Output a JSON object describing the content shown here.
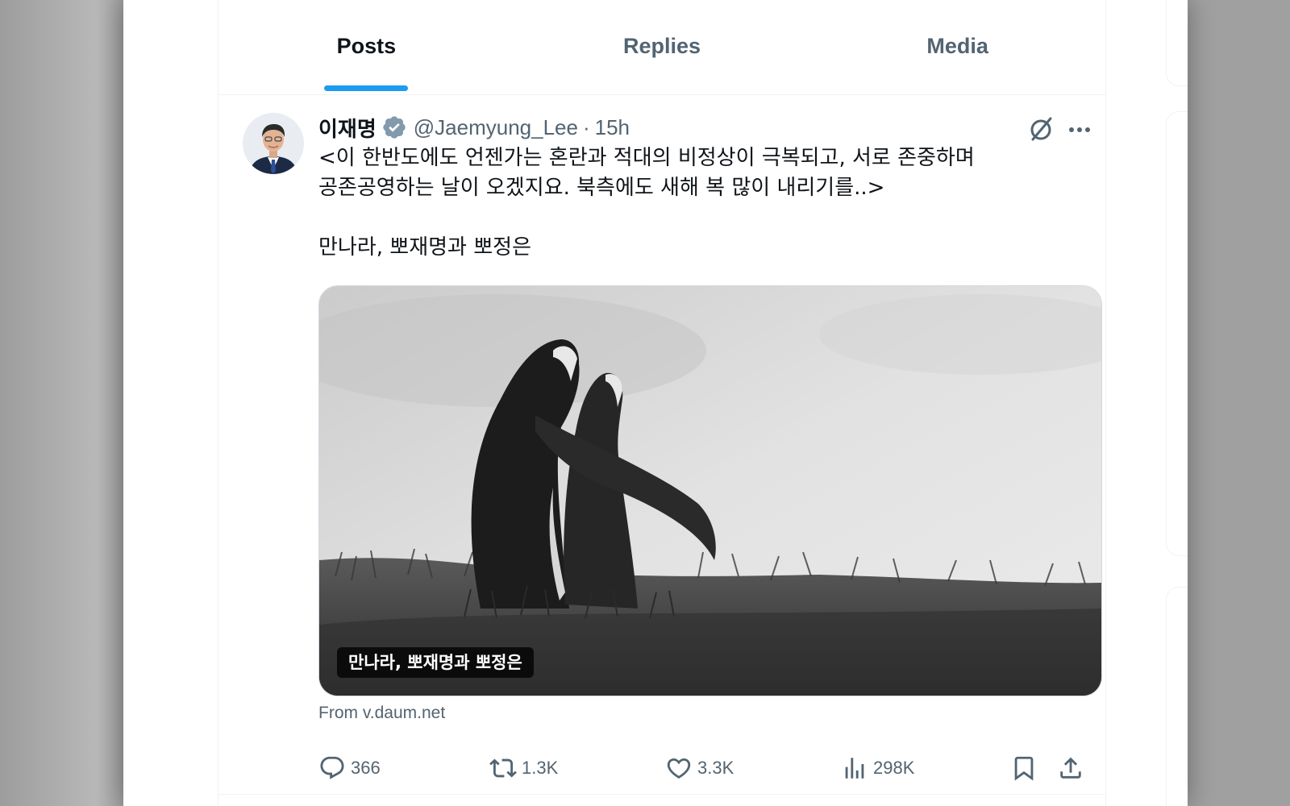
{
  "tabs": [
    {
      "label": "Posts",
      "active": true
    },
    {
      "label": "Replies",
      "active": false
    },
    {
      "label": "Media",
      "active": false
    }
  ],
  "tweet": {
    "author": {
      "display_name": "이재명",
      "handle": "@Jaemyung_Lee",
      "verified": true,
      "verified_icon": "verified-badge-icon"
    },
    "separator": "·",
    "time": "15h",
    "text": "<이 한반도에도 언젠가는 혼란과 적대의 비정상이 극복되고, 서로 존중하며 공존공영하는 날이 오겠지요. 북측에도 새해 복 많이 내리기를..>\n\n만나라, 뽀재명과 뽀정은",
    "media": {
      "caption": "만나라, 뽀재명과 뽀정은"
    },
    "link_source": "From v.daum.net",
    "actions": {
      "replies": "366",
      "reposts": "1.3K",
      "likes": "3.3K",
      "views": "298K"
    }
  },
  "colors": {
    "accent": "#1d9bf0",
    "text_primary": "#0f1419",
    "text_secondary": "#536471",
    "border": "#eff3f4",
    "verified_badge": "#829aab"
  },
  "icons": {
    "grok": "grok-icon",
    "more": "more-icon",
    "reply": "reply-icon",
    "repost": "repost-icon",
    "like": "heart-icon",
    "views": "views-icon",
    "bookmark": "bookmark-icon",
    "share": "share-icon"
  }
}
